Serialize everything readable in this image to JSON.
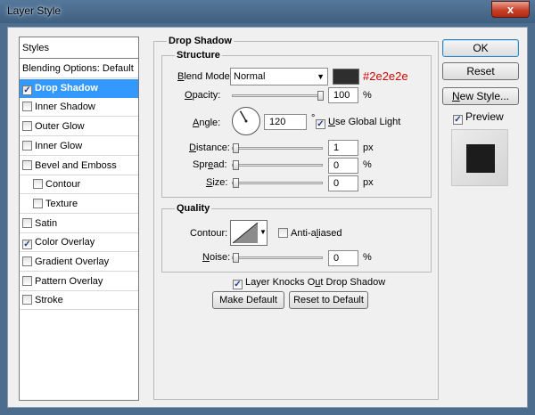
{
  "window": {
    "title": "Layer Style",
    "close_glyph": "x"
  },
  "styles_panel": {
    "header": "Styles",
    "items": [
      {
        "label": "Blending Options: Default",
        "checkbox": false,
        "checked": false,
        "selected": false,
        "indent": false
      },
      {
        "label": "Drop Shadow",
        "checkbox": true,
        "checked": true,
        "selected": true,
        "indent": false
      },
      {
        "label": "Inner Shadow",
        "checkbox": true,
        "checked": false,
        "selected": false,
        "indent": false
      },
      {
        "label": "Outer Glow",
        "checkbox": true,
        "checked": false,
        "selected": false,
        "indent": false
      },
      {
        "label": "Inner Glow",
        "checkbox": true,
        "checked": false,
        "selected": false,
        "indent": false
      },
      {
        "label": "Bevel and Emboss",
        "checkbox": true,
        "checked": false,
        "selected": false,
        "indent": false
      },
      {
        "label": "Contour",
        "checkbox": true,
        "checked": false,
        "selected": false,
        "indent": true
      },
      {
        "label": "Texture",
        "checkbox": true,
        "checked": false,
        "selected": false,
        "indent": true
      },
      {
        "label": "Satin",
        "checkbox": true,
        "checked": false,
        "selected": false,
        "indent": false
      },
      {
        "label": "Color Overlay",
        "checkbox": true,
        "checked": true,
        "selected": false,
        "indent": false
      },
      {
        "label": "Gradient Overlay",
        "checkbox": true,
        "checked": false,
        "selected": false,
        "indent": false
      },
      {
        "label": "Pattern Overlay",
        "checkbox": true,
        "checked": false,
        "selected": false,
        "indent": false
      },
      {
        "label": "Stroke",
        "checkbox": true,
        "checked": false,
        "selected": false,
        "indent": false
      }
    ]
  },
  "drop_shadow": {
    "title": "Drop Shadow",
    "structure": {
      "title": "Structure",
      "blend_mode_label": "Blend Mode:",
      "blend_mode_value": "Normal",
      "shadow_color": "#2e2e2e",
      "shadow_color_label": "#2e2e2e",
      "opacity_label": "Opacity:",
      "opacity_value": "100",
      "opacity_unit": "%",
      "opacity_fraction": 1.0,
      "angle_label": "Angle:",
      "angle_value": "120",
      "angle_unit": "°",
      "angle_degrees": 120,
      "use_global_light_label": "Use Global Light",
      "use_global_light": true,
      "distance_label": "Distance:",
      "distance_value": "1",
      "distance_unit": "px",
      "spread_label": "Spread:",
      "spread_value": "0",
      "spread_unit": "%",
      "size_label": "Size:",
      "size_value": "0",
      "size_unit": "px"
    },
    "quality": {
      "title": "Quality",
      "contour_label": "Contour:",
      "anti_aliased_label": "Anti-aliased",
      "anti_aliased": false,
      "noise_label": "Noise:",
      "noise_value": "0",
      "noise_unit": "%"
    },
    "knocks_out_label": "Layer Knocks Out Drop Shadow",
    "knocks_out": true,
    "make_default_label": "Make Default",
    "reset_to_default_label": "Reset to Default"
  },
  "buttons": {
    "ok": "OK",
    "reset": "Reset",
    "new_style": "New Style..."
  },
  "preview": {
    "label": "Preview",
    "checked": true,
    "swatch_color": "#1c1c1c"
  }
}
